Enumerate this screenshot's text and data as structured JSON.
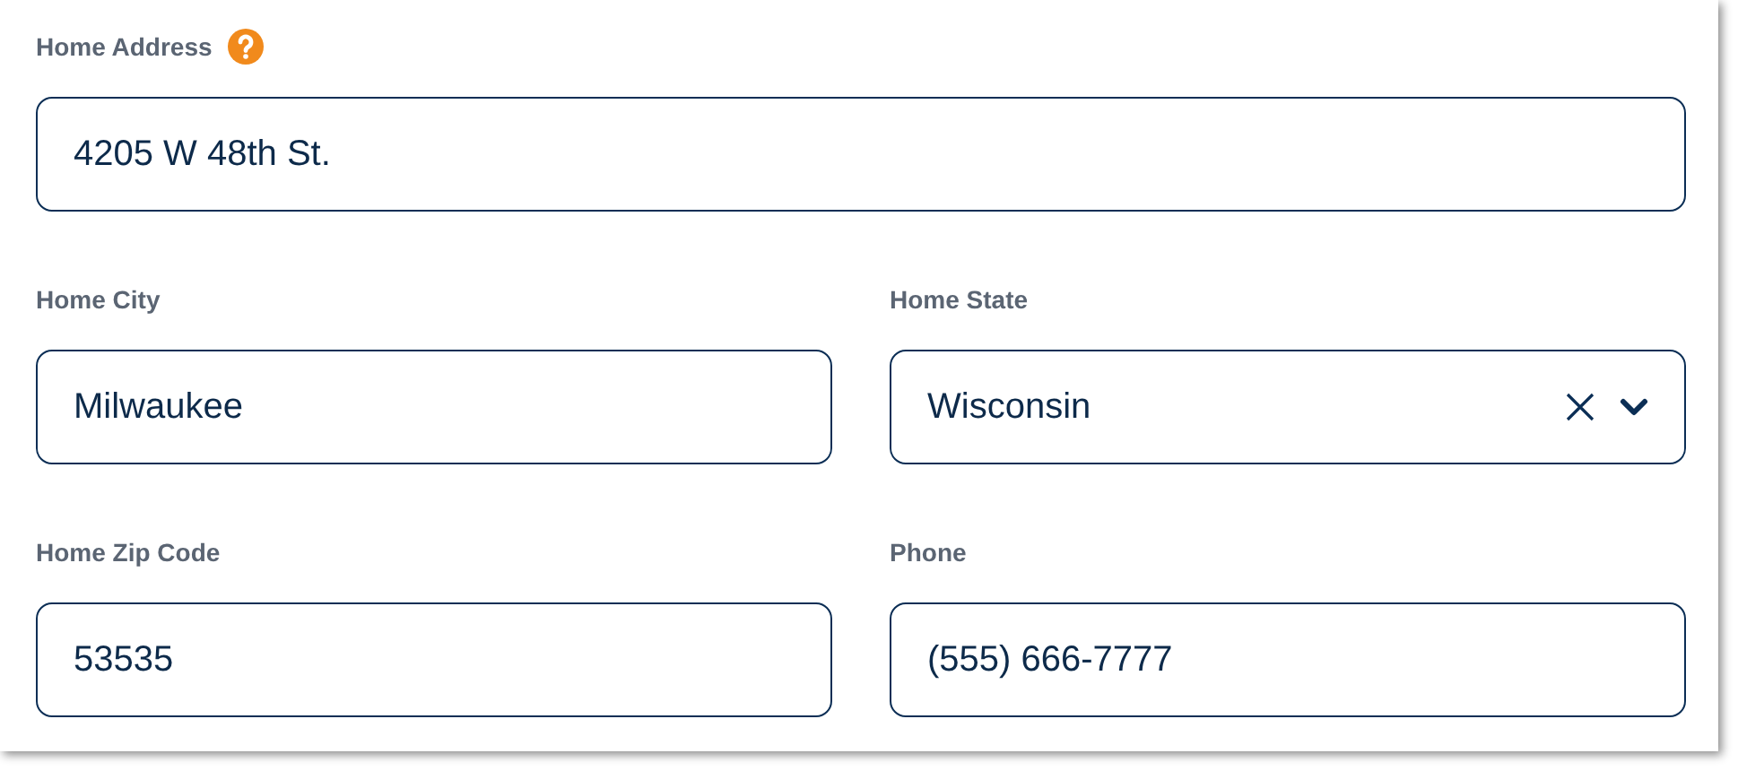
{
  "rows": [
    [
      {
        "label": "Home Address",
        "help": true,
        "kind": "text",
        "value": "4205 W 48th St."
      }
    ],
    [
      {
        "label": "Home City",
        "help": false,
        "kind": "text",
        "value": "Milwaukee"
      },
      {
        "label": "Home State",
        "help": false,
        "kind": "select",
        "value": "Wisconsin"
      }
    ],
    [
      {
        "label": "Home Zip Code",
        "help": false,
        "kind": "text",
        "value": "53535"
      },
      {
        "label": "Phone",
        "help": false,
        "kind": "text",
        "value": "(555) 666-7777"
      }
    ]
  ]
}
